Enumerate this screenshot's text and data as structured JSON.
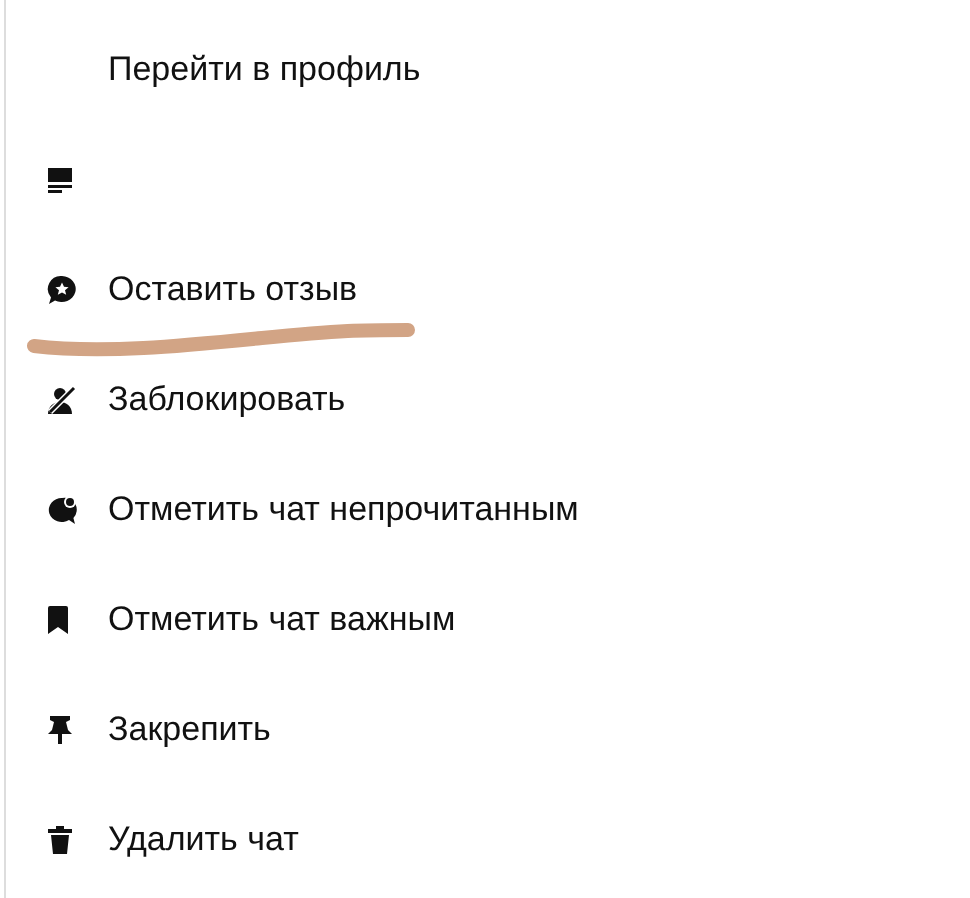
{
  "menu": {
    "items": [
      {
        "kind": "profile",
        "label": "Перейти в профиль"
      },
      {
        "kind": "screen"
      },
      {
        "kind": "review",
        "label": "Оставить отзыв",
        "underlined": true
      },
      {
        "kind": "block",
        "label": "Заблокировать"
      },
      {
        "kind": "unread",
        "label": "Отметить чат непрочитанным"
      },
      {
        "kind": "important",
        "label": "Отметить чат важным"
      },
      {
        "kind": "pin",
        "label": "Закрепить"
      },
      {
        "kind": "delete",
        "label": "Удалить чат"
      }
    ]
  }
}
